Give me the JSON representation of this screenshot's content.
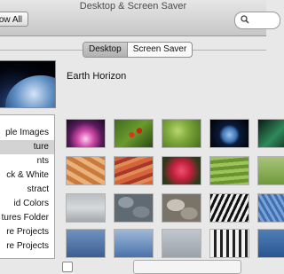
{
  "window": {
    "title": "Desktop & Screen Saver"
  },
  "toolbar": {
    "show_all": "ow All"
  },
  "tabs": [
    {
      "label": "Desktop",
      "selected": true
    },
    {
      "label": "Screen Saver",
      "selected": false
    }
  ],
  "current": {
    "name": "Earth Horizon"
  },
  "sidebar": {
    "items": [
      {
        "label": "ple Images",
        "selected": false
      },
      {
        "label": "ture",
        "selected": true
      },
      {
        "label": "nts",
        "selected": false
      },
      {
        "label": "ck & White",
        "selected": false
      },
      {
        "label": "stract",
        "selected": false
      },
      {
        "label": "id Colors",
        "selected": false
      },
      {
        "label": "tures Folder",
        "selected": false
      },
      {
        "label": "re Projects",
        "selected": false
      },
      {
        "label": "re Projects",
        "selected": false
      }
    ]
  },
  "thumbnails": [
    "Pink aurora",
    "Ladybugs on leaf",
    "Green leaf drop",
    "Earth from space",
    "Green aurora",
    "Orange sand waves",
    "Red rock layers",
    "Red lily",
    "Green terraces",
    "Green field",
    "Misty lake",
    "Grey pebbles",
    "Smooth stones",
    "Zebra stripes",
    "Blue sand ripples",
    "Blue water",
    "Blue horizon",
    "",
    "",
    ""
  ],
  "colors": {
    "accent": "#3875d7",
    "selected_row": "#d3d3d3"
  }
}
